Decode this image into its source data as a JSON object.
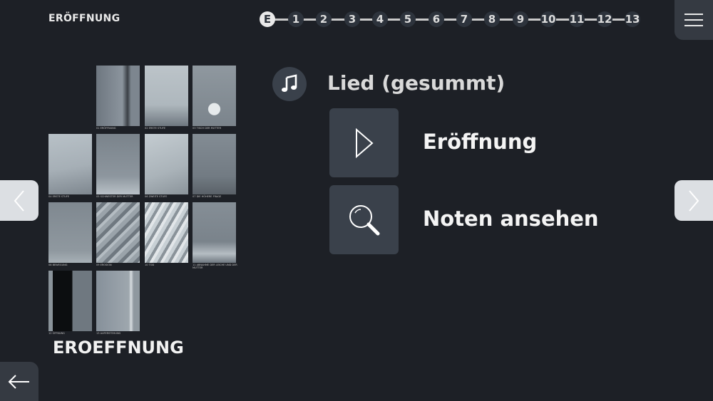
{
  "header": {
    "title": "ERÖFFNUNG"
  },
  "stepper": {
    "steps": [
      "E",
      "1",
      "2",
      "3",
      "4",
      "5",
      "6",
      "7",
      "8",
      "9",
      "10",
      "11",
      "12",
      "13"
    ],
    "active_index": 0
  },
  "thumbnails": [
    {
      "caption": "01 ERÖFFNUNG"
    },
    {
      "caption": "02 ERSTE STUFE"
    },
    {
      "caption": "03 TISCH DER MUTTER"
    },
    {
      "caption": "04 ERSTE STUFE"
    },
    {
      "caption": "05 SCHWESTER DER MUTTER"
    },
    {
      "caption": "06 ZWEITE STUFE"
    },
    {
      "caption": "07 DIE HÖHERE FRAGE"
    },
    {
      "caption": "08 BEWEGUNG"
    },
    {
      "caption": "09 EROSION"
    },
    {
      "caption": "10 TOD"
    },
    {
      "caption": "11 ABNAHME DER LEICHE UND DER MUTTER"
    },
    {
      "caption": "12 ÖFFNUNG"
    },
    {
      "caption": "13 AUFERSTEHUNG"
    }
  ],
  "scene_label": "EROEFFNUNG",
  "song": {
    "title": "Lied (gesummt)",
    "icon": "music-note-icon"
  },
  "actions": [
    {
      "label": "Eröffnung",
      "icon": "play-icon"
    },
    {
      "label": "Noten ansehen",
      "icon": "magnifier-icon"
    }
  ],
  "colors": {
    "background": "#1d2026",
    "panel": "#3a414b",
    "nav": "#dcdfe3"
  }
}
